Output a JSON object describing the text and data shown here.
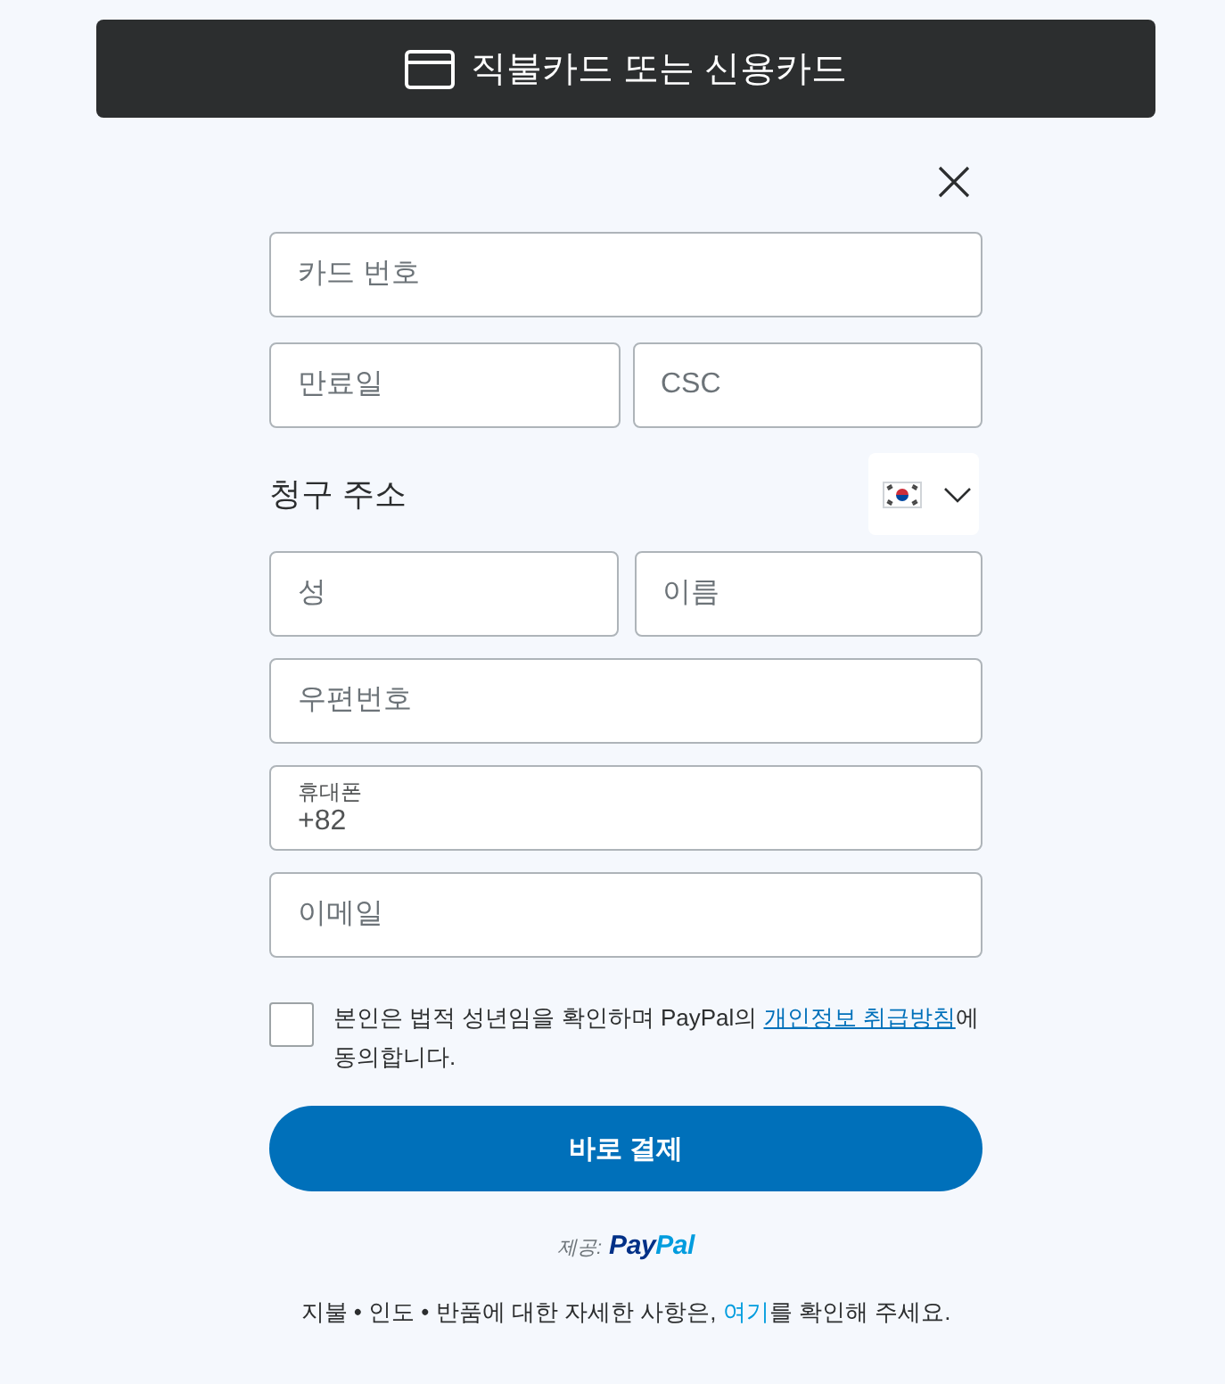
{
  "header": {
    "title": "직불카드 또는 신용카드"
  },
  "card": {
    "number": {
      "placeholder": "카드 번호"
    },
    "expiry": {
      "placeholder": "만료일"
    },
    "csc": {
      "placeholder": "CSC"
    }
  },
  "billing_address": {
    "heading": "청구 주소",
    "name_fields": [
      {
        "placeholder": "성"
      },
      {
        "placeholder": "이름"
      }
    ],
    "postal_code": {
      "placeholder": "우편번호"
    },
    "phone": {
      "label": "휴대폰",
      "value": "+82"
    },
    "email": {
      "placeholder": "이메일"
    }
  },
  "consent": {
    "checked": false,
    "text_before": "본인은 법적 성년임을 확인하며 PayPal의 ",
    "link": "개인정보 취급방침",
    "text_after": "에 동의합니다."
  },
  "pay_button": {
    "label": "바로 결제"
  },
  "powered_by": {
    "label": "제공:",
    "brand": [
      {
        "text": "Pay",
        "color": "#003087"
      },
      {
        "text": "Pal",
        "color": "#009cde"
      }
    ]
  },
  "footer": {
    "text_before": "지불 • 인도 • 반품에 대한 자세한 사항은, ",
    "link": "여기",
    "text_after": "를 확인해 주세요."
  }
}
